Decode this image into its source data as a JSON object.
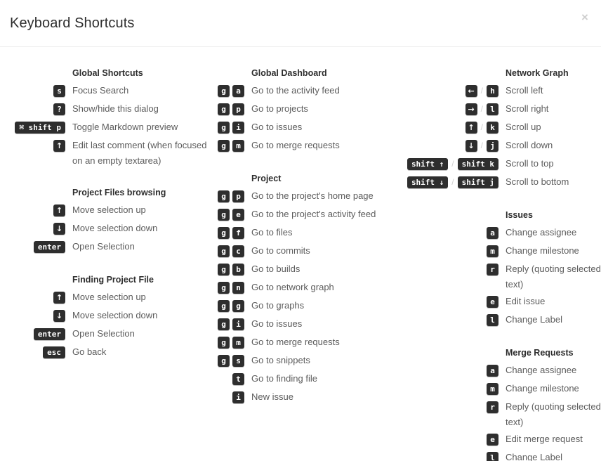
{
  "header": {
    "title": "Keyboard Shortcuts",
    "close_label": "×"
  },
  "separator": "/",
  "columns": [
    {
      "name": "column-1",
      "sections": [
        {
          "title": "Global Shortcuts",
          "shortcuts": [
            {
              "keys": [
                {
                  "type": "key",
                  "label": "s"
                }
              ],
              "description": "Focus Search"
            },
            {
              "keys": [
                {
                  "type": "key",
                  "label": "?"
                }
              ],
              "description": "Show/hide this dialog"
            },
            {
              "keys": [
                {
                  "type": "key",
                  "label": "⌘ shift p",
                  "wide": true
                }
              ],
              "description": "Toggle Markdown preview"
            },
            {
              "keys": [
                {
                  "type": "key",
                  "label": "↑",
                  "glyph": true
                }
              ],
              "description": "Edit last comment (when focused on an empty textarea)"
            }
          ]
        },
        {
          "title": "Project Files browsing",
          "shortcuts": [
            {
              "keys": [
                {
                  "type": "key",
                  "label": "↑",
                  "glyph": true
                }
              ],
              "description": "Move selection up"
            },
            {
              "keys": [
                {
                  "type": "key",
                  "label": "↓",
                  "glyph": true
                }
              ],
              "description": "Move selection down"
            },
            {
              "keys": [
                {
                  "type": "key",
                  "label": "enter",
                  "wide": true
                }
              ],
              "description": "Open Selection"
            }
          ]
        },
        {
          "title": "Finding Project File",
          "shortcuts": [
            {
              "keys": [
                {
                  "type": "key",
                  "label": "↑",
                  "glyph": true
                }
              ],
              "description": "Move selection up"
            },
            {
              "keys": [
                {
                  "type": "key",
                  "label": "↓",
                  "glyph": true
                }
              ],
              "description": "Move selection down"
            },
            {
              "keys": [
                {
                  "type": "key",
                  "label": "enter",
                  "wide": true
                }
              ],
              "description": "Open Selection"
            },
            {
              "keys": [
                {
                  "type": "key",
                  "label": "esc",
                  "wide": true
                }
              ],
              "description": "Go back"
            }
          ]
        }
      ]
    },
    {
      "name": "column-2",
      "sections": [
        {
          "title": "Global Dashboard",
          "shortcuts": [
            {
              "keys": [
                {
                  "type": "key",
                  "label": "g"
                },
                {
                  "type": "key",
                  "label": "a"
                }
              ],
              "description": "Go to the activity feed"
            },
            {
              "keys": [
                {
                  "type": "key",
                  "label": "g"
                },
                {
                  "type": "key",
                  "label": "p"
                }
              ],
              "description": "Go to projects"
            },
            {
              "keys": [
                {
                  "type": "key",
                  "label": "g"
                },
                {
                  "type": "key",
                  "label": "i"
                }
              ],
              "description": "Go to issues"
            },
            {
              "keys": [
                {
                  "type": "key",
                  "label": "g"
                },
                {
                  "type": "key",
                  "label": "m"
                }
              ],
              "description": "Go to merge requests"
            }
          ]
        },
        {
          "title": "Project",
          "shortcuts": [
            {
              "keys": [
                {
                  "type": "key",
                  "label": "g"
                },
                {
                  "type": "key",
                  "label": "p"
                }
              ],
              "description": "Go to the project's home page"
            },
            {
              "keys": [
                {
                  "type": "key",
                  "label": "g"
                },
                {
                  "type": "key",
                  "label": "e"
                }
              ],
              "description": "Go to the project's activity feed"
            },
            {
              "keys": [
                {
                  "type": "key",
                  "label": "g"
                },
                {
                  "type": "key",
                  "label": "f"
                }
              ],
              "description": "Go to files"
            },
            {
              "keys": [
                {
                  "type": "key",
                  "label": "g"
                },
                {
                  "type": "key",
                  "label": "c"
                }
              ],
              "description": "Go to commits"
            },
            {
              "keys": [
                {
                  "type": "key",
                  "label": "g"
                },
                {
                  "type": "key",
                  "label": "b"
                }
              ],
              "description": "Go to builds"
            },
            {
              "keys": [
                {
                  "type": "key",
                  "label": "g"
                },
                {
                  "type": "key",
                  "label": "n"
                }
              ],
              "description": "Go to network graph"
            },
            {
              "keys": [
                {
                  "type": "key",
                  "label": "g"
                },
                {
                  "type": "key",
                  "label": "g"
                }
              ],
              "description": "Go to graphs"
            },
            {
              "keys": [
                {
                  "type": "key",
                  "label": "g"
                },
                {
                  "type": "key",
                  "label": "i"
                }
              ],
              "description": "Go to issues"
            },
            {
              "keys": [
                {
                  "type": "key",
                  "label": "g"
                },
                {
                  "type": "key",
                  "label": "m"
                }
              ],
              "description": "Go to merge requests"
            },
            {
              "keys": [
                {
                  "type": "key",
                  "label": "g"
                },
                {
                  "type": "key",
                  "label": "s"
                }
              ],
              "description": "Go to snippets"
            },
            {
              "keys": [
                {
                  "type": "key",
                  "label": "t"
                }
              ],
              "description": "Go to finding file"
            },
            {
              "keys": [
                {
                  "type": "key",
                  "label": "i"
                }
              ],
              "description": "New issue"
            }
          ]
        }
      ]
    },
    {
      "name": "column-3",
      "sections": [
        {
          "title": "Network Graph",
          "shortcuts": [
            {
              "keys": [
                {
                  "type": "key",
                  "label": "←",
                  "glyph": true
                },
                {
                  "type": "sep"
                },
                {
                  "type": "key",
                  "label": "h"
                }
              ],
              "description": "Scroll left"
            },
            {
              "keys": [
                {
                  "type": "key",
                  "label": "→",
                  "glyph": true
                },
                {
                  "type": "sep"
                },
                {
                  "type": "key",
                  "label": "l"
                }
              ],
              "description": "Scroll right"
            },
            {
              "keys": [
                {
                  "type": "key",
                  "label": "↑",
                  "glyph": true
                },
                {
                  "type": "sep"
                },
                {
                  "type": "key",
                  "label": "k"
                }
              ],
              "description": "Scroll up"
            },
            {
              "keys": [
                {
                  "type": "key",
                  "label": "↓",
                  "glyph": true
                },
                {
                  "type": "sep"
                },
                {
                  "type": "key",
                  "label": "j"
                }
              ],
              "description": "Scroll down"
            },
            {
              "keys": [
                {
                  "type": "key",
                  "label": "shift ↑",
                  "wide": true
                },
                {
                  "type": "sep"
                },
                {
                  "type": "key",
                  "label": "shift k",
                  "wide": true
                }
              ],
              "description": "Scroll to top"
            },
            {
              "keys": [
                {
                  "type": "key",
                  "label": "shift ↓",
                  "wide": true
                },
                {
                  "type": "sep"
                },
                {
                  "type": "key",
                  "label": "shift j",
                  "wide": true
                }
              ],
              "description": "Scroll to bottom"
            }
          ]
        },
        {
          "title": "Issues",
          "shortcuts": [
            {
              "keys": [
                {
                  "type": "key",
                  "label": "a"
                }
              ],
              "description": "Change assignee"
            },
            {
              "keys": [
                {
                  "type": "key",
                  "label": "m"
                }
              ],
              "description": "Change milestone"
            },
            {
              "keys": [
                {
                  "type": "key",
                  "label": "r"
                }
              ],
              "description": "Reply (quoting selected text)"
            },
            {
              "keys": [
                {
                  "type": "key",
                  "label": "e"
                }
              ],
              "description": "Edit issue"
            },
            {
              "keys": [
                {
                  "type": "key",
                  "label": "l"
                }
              ],
              "description": "Change Label"
            }
          ]
        },
        {
          "title": "Merge Requests",
          "shortcuts": [
            {
              "keys": [
                {
                  "type": "key",
                  "label": "a"
                }
              ],
              "description": "Change assignee"
            },
            {
              "keys": [
                {
                  "type": "key",
                  "label": "m"
                }
              ],
              "description": "Change milestone"
            },
            {
              "keys": [
                {
                  "type": "key",
                  "label": "r"
                }
              ],
              "description": "Reply (quoting selected text)"
            },
            {
              "keys": [
                {
                  "type": "key",
                  "label": "e"
                }
              ],
              "description": "Edit merge request"
            },
            {
              "keys": [
                {
                  "type": "key",
                  "label": "l"
                }
              ],
              "description": "Change Label"
            }
          ]
        }
      ]
    }
  ],
  "colors": {
    "key_background": "#2e2e2e",
    "key_text": "#ffffff",
    "description_text": "#5c5c5c",
    "title_text": "#2e2e2e",
    "separator": "#d0d0d0",
    "border": "#ededed"
  }
}
